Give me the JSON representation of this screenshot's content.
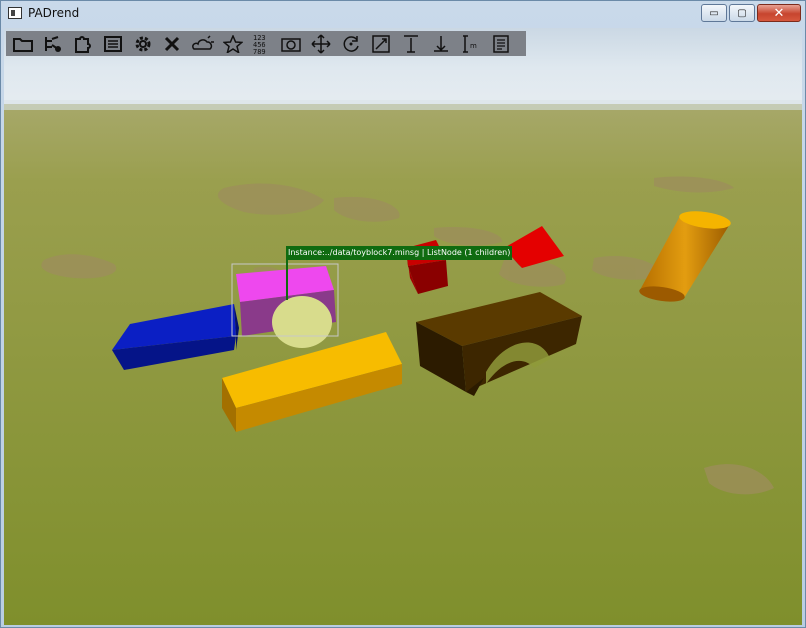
{
  "window": {
    "title": "PADrend",
    "minimize_glyph": "▭",
    "maximize_glyph": "▢",
    "close_glyph": "✕"
  },
  "toolbar": {
    "items": [
      {
        "icon": "folder-icon",
        "tooltip": ""
      },
      {
        "icon": "scene-tree-icon",
        "tooltip": ""
      },
      {
        "icon": "puzzle-plugin-icon",
        "tooltip": ""
      },
      {
        "icon": "list-document-icon",
        "tooltip": ""
      },
      {
        "icon": "gear-icon",
        "tooltip": ""
      },
      {
        "icon": "tools-icon",
        "tooltip": ""
      },
      {
        "icon": "sun-cloud-icon",
        "tooltip": ""
      },
      {
        "icon": "star-icon",
        "tooltip": ""
      },
      {
        "icon": "numbers-grid-icon",
        "tooltip": "1 2 3 4 5 6 7 8 9"
      },
      {
        "icon": "camera-view-icon",
        "tooltip": ""
      },
      {
        "icon": "move-arrows-icon",
        "tooltip": ""
      },
      {
        "icon": "rotate-icon",
        "tooltip": ""
      },
      {
        "icon": "scale-icon",
        "tooltip": ""
      },
      {
        "icon": "align-top-icon",
        "tooltip": ""
      },
      {
        "icon": "anchor-ground-icon",
        "tooltip": ""
      },
      {
        "icon": "measure-icon",
        "tooltip": ""
      },
      {
        "icon": "properties-panel-icon",
        "tooltip": ""
      }
    ],
    "numbers_glyph": "1 2 3\n4 5 6\n7 8 9"
  },
  "selection_tooltip": "Instance:../data/toyblock7.minsg | ListNode (1 children)",
  "colors": {
    "sky_top": "#cbd9e6",
    "ground": "#8f9a3a",
    "blue_block": "#0a1fa8",
    "magenta_block": "#e840e8",
    "purple_block": "#8a3a8a",
    "red_block": "#b00000",
    "red_wedge": "#e00000",
    "yellow_block": "#f5b800",
    "brown_arch": "#3a2400",
    "orange_cylinder": "#e09a00",
    "tooltip_bg": "#0f6b10"
  }
}
